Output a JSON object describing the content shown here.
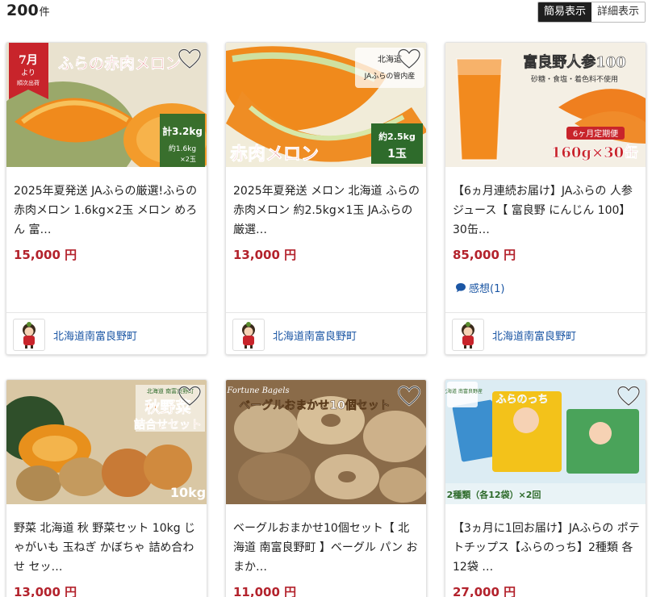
{
  "header": {
    "count": "200",
    "count_unit": "件",
    "view_simple": "簡易表示",
    "view_detail": "詳細表示"
  },
  "products": [
    {
      "title": "2025年夏発送 JAふらの厳選!ふらの赤肉メロン 1.6kg×2玉 メロン めろん 富…",
      "price": "15,000 円",
      "municipality": "北海道南富良野町",
      "img_banner": "ふらの赤肉メロン",
      "img_ribbon_top": "7月",
      "img_ribbon_mid": "より",
      "img_ribbon_bottom": "順次出荷",
      "img_weight_main": "計3.2kg",
      "img_weight_sub": "約1.6kg",
      "img_weight_sub2": "×2玉"
    },
    {
      "title": "2025年夏発送 メロン 北海道 ふらの 赤肉メロン 約2.5kg×1玉 JAふらの 厳選…",
      "price": "13,000 円",
      "municipality": "北海道南富良野町",
      "img_banner": "赤肉メロン",
      "img_tag_1": "北海道",
      "img_tag_2": "JAふらの管内産",
      "img_weight_main": "約2.5kg",
      "img_weight_sub": "1玉"
    },
    {
      "title": "【6ヵ月連続お届け】JAふらの 人参 ジュース【 富良野 にんじん 100】30缶…",
      "price": "85,000 円",
      "review": "感想(1)",
      "municipality": "北海道南富良野町",
      "img_banner": "富良野人参100",
      "img_sub": "砂糖・食塩・着色料不使用",
      "img_tag": "6ヶ月定期便",
      "img_bottom": "160g×30缶"
    },
    {
      "title": "野菜 北海道 秋 野菜セット 10kg じゃがいも 玉ねぎ かぼちゃ 詰め合わせ セッ…",
      "price": "13,000 円",
      "img_tag": "北海道 南富良野町",
      "img_banner_1": "秋野菜",
      "img_banner_2": "詰合せセット",
      "img_weight": "10kg"
    },
    {
      "title": "ベーグルおまかせ10個セット【 北海道 南富良野町 】ベーグル パン おまか…",
      "price": "11,000 円",
      "img_brand": "Fortune Bagels",
      "img_banner": "ベーグルおまかせ10個セット"
    },
    {
      "title": "【3ヵ月に1回お届け】JAふらの ポテトチップス【ふらのっち】2種類 各12袋 …",
      "price": "27,000 円",
      "img_badge": "北海道 南富良野産",
      "img_brand": "ふらのっち",
      "img_bottom": "2種類（各12袋）×2回"
    }
  ],
  "colors": {
    "price": "#b3222c",
    "link": "#1b56a4",
    "toggle_active": "#1f1f1f"
  },
  "icons": {
    "favorite": "heart-outline-icon",
    "review": "speech-bubble-icon",
    "avatar": "mascot-avatar-icon"
  }
}
